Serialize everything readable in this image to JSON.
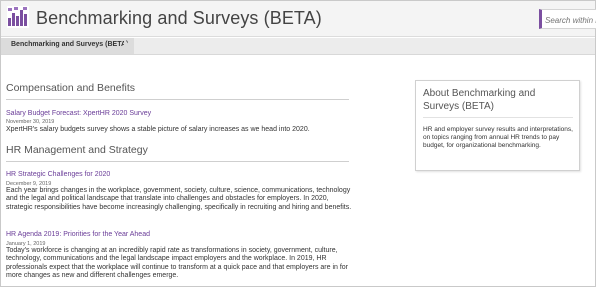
{
  "header": {
    "title": "Benchmarking and Surveys (BETA)",
    "search_placeholder": "Search within Be",
    "accent_color": "#7b4fa0"
  },
  "breadcrumb": {
    "items": [
      "Benchmarking and Surveys (BETA)"
    ]
  },
  "sections": [
    {
      "heading": "Compensation and Benefits",
      "items": [
        {
          "title": "Salary Budget Forecast: XpertHR 2020 Survey",
          "date": "November 30, 2019",
          "description": "XpertHR's salary budgets survey shows a stable picture of salary increases as we head into 2020."
        }
      ]
    },
    {
      "heading": "HR Management and Strategy",
      "items": [
        {
          "title": "HR Strategic Challenges for 2020",
          "date": "December 9, 2019",
          "description": "Each year brings changes in the workplace, government, society, culture, science, communications, technology and the legal and political landscape that translate into challenges and obstacles for employers. In 2020, strategic responsibilities have become increasingly challenging, specifically in recruiting and hiring and benefits."
        },
        {
          "title": "HR Agenda 2019: Priorities for the Year Ahead",
          "date": "January 1, 2019",
          "description": "Today's workforce is changing at an incredibly rapid rate as transformations in society, government, culture, technology, communications and the legal landscape impact employers and the workplace. In 2019, HR professionals expect that the workplace will continue to transform at a quick pace and that employers are in for more changes as new and different challenges emerge."
        }
      ]
    }
  ],
  "sidebar": {
    "about_title": "About Benchmarking and Surveys (BETA)",
    "about_text": "HR and employer survey results and interpretations, on topics ranging from annual HR trends to pay budget, for organizational benchmarking."
  },
  "colors": {
    "link": "#6a3d98",
    "logo": "#7b4fa0"
  }
}
